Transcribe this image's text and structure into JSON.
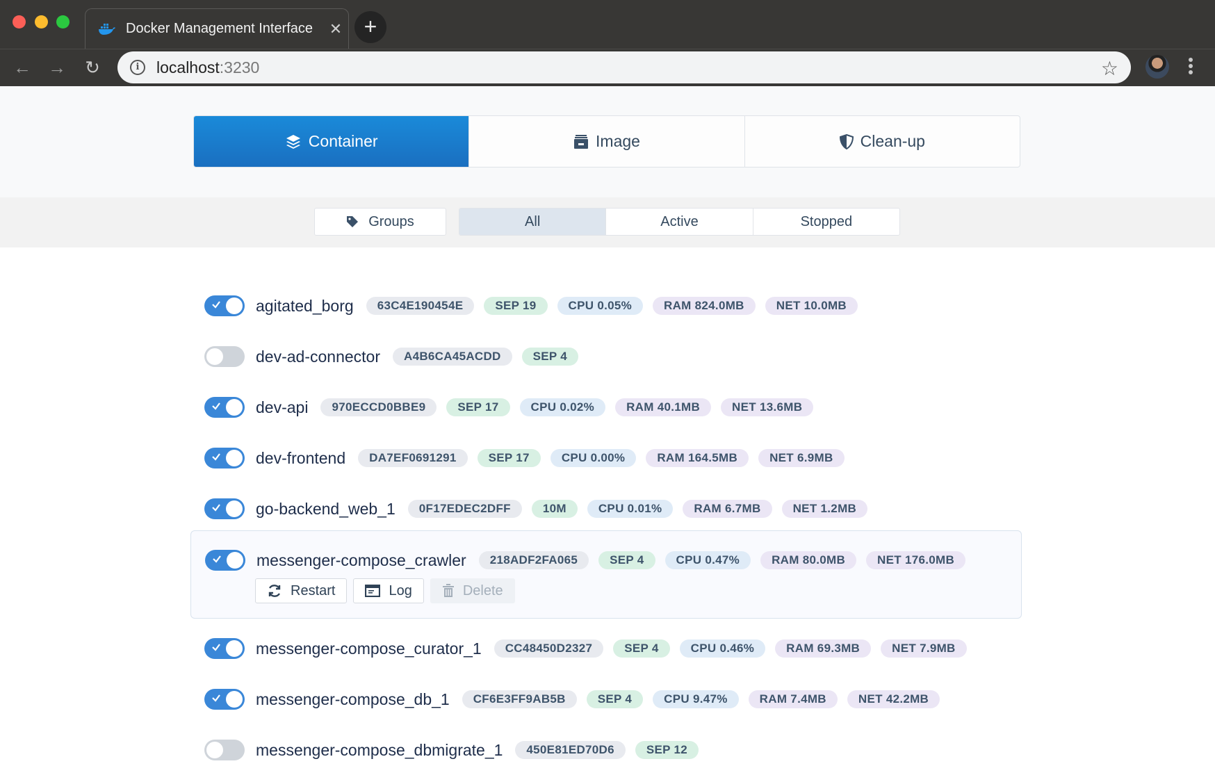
{
  "browser": {
    "tab_title": "Docker Management Interface",
    "address_host": "localhost",
    "address_port": ":3230",
    "new_tab_label": "+",
    "close_tab_label": "✕"
  },
  "main_tabs": [
    {
      "label": "Container",
      "icon": "layers-icon",
      "active": true
    },
    {
      "label": "Image",
      "icon": "archive-icon",
      "active": false
    },
    {
      "label": "Clean-up",
      "icon": "shield-icon",
      "active": false
    }
  ],
  "filters": {
    "groups_label": "Groups",
    "segments": [
      {
        "label": "All",
        "active": true
      },
      {
        "label": "Active",
        "active": false
      },
      {
        "label": "Stopped",
        "active": false
      }
    ]
  },
  "containers": [
    {
      "name": "agitated_borg",
      "running": true,
      "id": "63C4E190454E",
      "date": "SEP 19",
      "cpu": "CPU 0.05%",
      "ram": "RAM 824.0MB",
      "net": "NET 10.0MB"
    },
    {
      "name": "dev-ad-connector",
      "running": false,
      "id": "A4B6CA45ACDD",
      "date": "SEP 4"
    },
    {
      "name": "dev-api",
      "running": true,
      "id": "970ECCD0BBE9",
      "date": "SEP 17",
      "cpu": "CPU 0.02%",
      "ram": "RAM 40.1MB",
      "net": "NET 13.6MB"
    },
    {
      "name": "dev-frontend",
      "running": true,
      "id": "DA7EF0691291",
      "date": "SEP 17",
      "cpu": "CPU 0.00%",
      "ram": "RAM 164.5MB",
      "net": "NET 6.9MB"
    },
    {
      "name": "go-backend_web_1",
      "running": true,
      "id": "0F17EDEC2DFF",
      "date": "10M",
      "cpu": "CPU 0.01%",
      "ram": "RAM 6.7MB",
      "net": "NET 1.2MB"
    },
    {
      "name": "messenger-compose_crawler",
      "running": true,
      "id": "218ADF2FA065",
      "date": "SEP 4",
      "cpu": "CPU 0.47%",
      "ram": "RAM 80.0MB",
      "net": "NET 176.0MB",
      "expanded": true
    },
    {
      "name": "messenger-compose_curator_1",
      "running": true,
      "id": "CC48450D2327",
      "date": "SEP 4",
      "cpu": "CPU 0.46%",
      "ram": "RAM 69.3MB",
      "net": "NET 7.9MB"
    },
    {
      "name": "messenger-compose_db_1",
      "running": true,
      "id": "CF6E3FF9AB5B",
      "date": "SEP 4",
      "cpu": "CPU 9.47%",
      "ram": "RAM 7.4MB",
      "net": "NET 42.2MB"
    },
    {
      "name": "messenger-compose_dbmigrate_1",
      "running": false,
      "id": "450E81ED70D6",
      "date": "SEP 12"
    }
  ],
  "row_actions": {
    "restart_label": "Restart",
    "log_label": "Log",
    "delete_label": "Delete",
    "delete_disabled": true
  },
  "colors": {
    "accent": "#1a7fd0",
    "toggle_on": "#3a87d8",
    "toggle_off": "#cfd4da",
    "badge_id": "#e8eaef",
    "badge_date": "#d8f0e3",
    "badge_cpu": "#dfebf7",
    "badge_mem_net": "#ebe6f5"
  }
}
